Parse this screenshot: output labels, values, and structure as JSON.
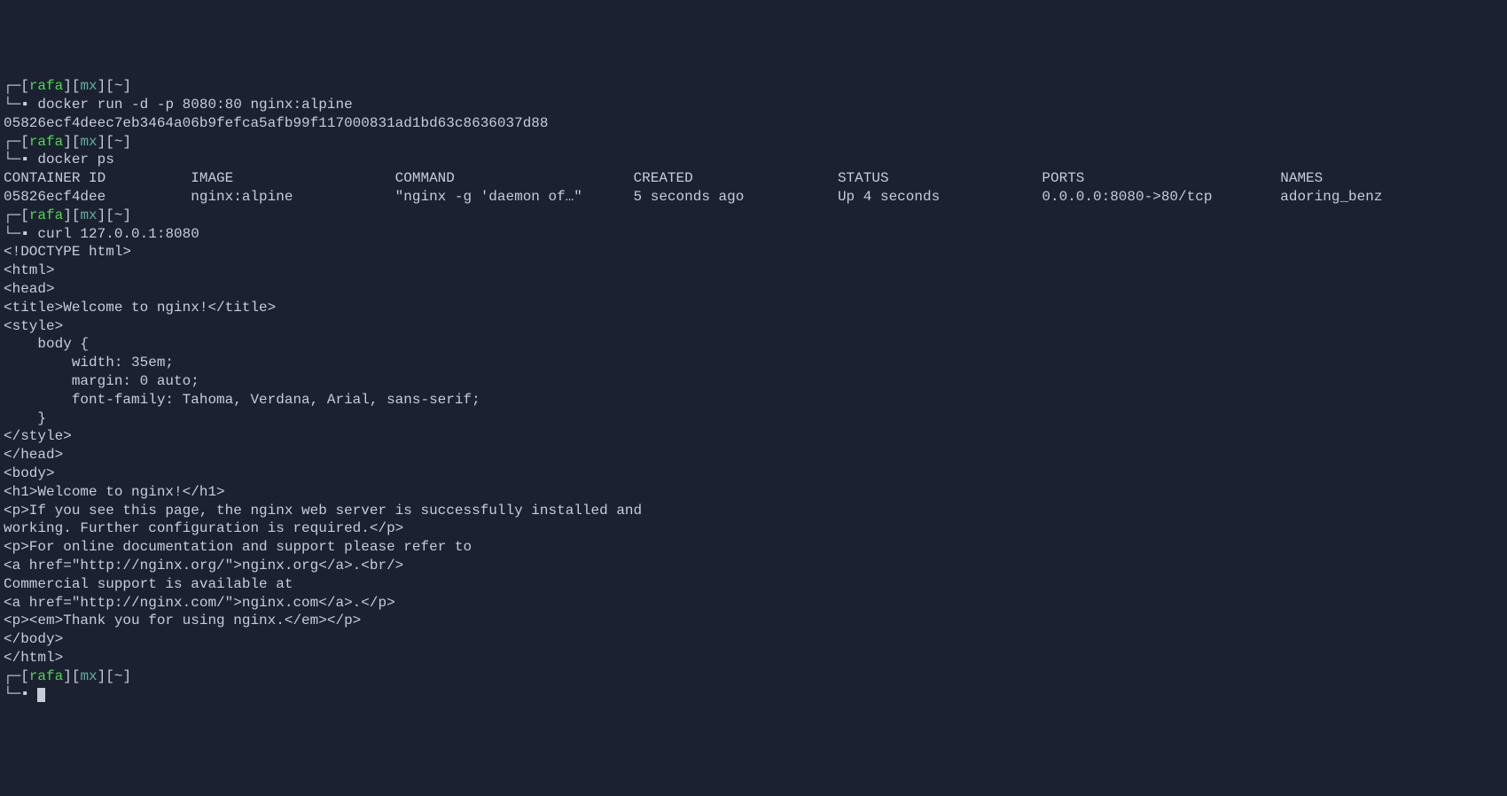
{
  "prompts": {
    "box_tl": "┌─",
    "box_bl": "└─",
    "bracket_open": "[",
    "bracket_close": "]",
    "user": "rafa",
    "host": "mx",
    "cwd": "~",
    "prompt_cursor": "▪"
  },
  "cmd1": {
    "text": " docker run -d -p 8080:80 nginx:alpine"
  },
  "out1": {
    "text": "05826ecf4deec7eb3464a06b9fefca5afb99f117000831ad1bd63c8636037d88"
  },
  "cmd2": {
    "text": " docker ps"
  },
  "ps_header": {
    "container_id": "CONTAINER ID",
    "image": "IMAGE",
    "command": "COMMAND",
    "created": "CREATED",
    "status": "STATUS",
    "ports": "PORTS",
    "names": "NAMES"
  },
  "ps_row": {
    "container_id": "05826ecf4dee",
    "image": "nginx:alpine",
    "command": "\"nginx -g 'daemon of…\"",
    "created": "5 seconds ago",
    "status": "Up 4 seconds",
    "ports": "0.0.0.0:8080->80/tcp",
    "names": "adoring_benz"
  },
  "cmd3": {
    "text": " curl 127.0.0.1:8080"
  },
  "curl_output": {
    "l01": "<!DOCTYPE html>",
    "l02": "<html>",
    "l03": "<head>",
    "l04": "<title>Welcome to nginx!</title>",
    "l05": "<style>",
    "l06": "    body {",
    "l07": "        width: 35em;",
    "l08": "        margin: 0 auto;",
    "l09": "        font-family: Tahoma, Verdana, Arial, sans-serif;",
    "l10": "    }",
    "l11": "</style>",
    "l12": "</head>",
    "l13": "<body>",
    "l14": "<h1>Welcome to nginx!</h1>",
    "l15": "<p>If you see this page, the nginx web server is successfully installed and",
    "l16": "working. Further configuration is required.</p>",
    "l17": "",
    "l18": "<p>For online documentation and support please refer to",
    "l19": "<a href=\"http://nginx.org/\">nginx.org</a>.<br/>",
    "l20": "Commercial support is available at",
    "l21": "<a href=\"http://nginx.com/\">nginx.com</a>.</p>",
    "l22": "",
    "l23": "<p><em>Thank you for using nginx.</em></p>",
    "l24": "</body>",
    "l25": "</html>"
  }
}
